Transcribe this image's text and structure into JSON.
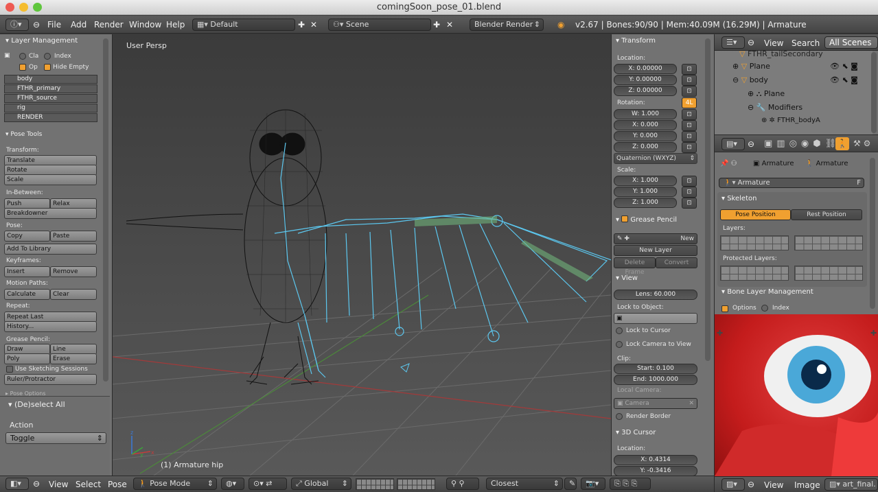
{
  "window": {
    "title": "comingSoon_pose_01.blend"
  },
  "topbar": {
    "menus": [
      "File",
      "Add",
      "Render",
      "Window",
      "Help"
    ],
    "screen_layout": "Default",
    "scene": "Scene",
    "render_engine": "Blender Render",
    "info": "v2.67 | Bones:90/90 | Mem:40.09M (16.29M) | Armature"
  },
  "left_panel": {
    "layer_management_title": "Layer Management",
    "cla": "Cla",
    "index": "Index",
    "op": "Op",
    "hide_empty": "Hide Empty",
    "layers": [
      "body",
      "FTHR_primary",
      "FTHR_source",
      "rig",
      "RENDER"
    ],
    "pose_tools_title": "Pose Tools",
    "transform_label": "Transform:",
    "translate": "Translate",
    "rotate": "Rotate",
    "scale": "Scale",
    "in_between_label": "In-Between:",
    "push": "Push",
    "relax": "Relax",
    "breakdowner": "Breakdowner",
    "pose_label": "Pose:",
    "copy": "Copy",
    "paste": "Paste",
    "add_to_library": "Add To Library",
    "keyframes_label": "Keyframes:",
    "insert": "Insert",
    "remove": "Remove",
    "motion_paths_label": "Motion Paths:",
    "calculate": "Calculate",
    "clear": "Clear",
    "repeat_label": "Repeat:",
    "repeat_last": "Repeat Last",
    "history": "History...",
    "grease_pencil_label": "Grease Pencil:",
    "draw": "Draw",
    "line": "Line",
    "poly": "Poly",
    "erase": "Erase",
    "use_sketching": "Use Sketching Sessions",
    "ruler": "Ruler/Protractor",
    "pose_options": "Pose Options",
    "deselect_all": "(De)select All",
    "action_label": "Action",
    "action_value": "Toggle"
  },
  "viewport": {
    "view_name": "User Persp",
    "selected": "(1) Armature hip"
  },
  "n_panel": {
    "transform_title": "Transform",
    "location_label": "Location:",
    "loc": [
      "X: 0.00000",
      "Y: 0.00000",
      "Z: 0.00000"
    ],
    "rotation_label": "Rotation:",
    "rot_badge": "4L",
    "rot": [
      "W: 1.000",
      "X: 0.000",
      "Y: 0.000",
      "Z: 0.000"
    ],
    "rotation_mode": "Quaternion (WXYZ)",
    "scale_label": "Scale:",
    "scale": [
      "X: 1.000",
      "Y: 1.000",
      "Z: 1.000"
    ],
    "grease_pencil_title": "Grease Pencil",
    "new": "New",
    "new_layer": "New Layer",
    "delete_frame": "Delete Frame",
    "convert": "Convert",
    "view_title": "View",
    "lens": "Lens: 60.000",
    "lock_to_object": "Lock to Object:",
    "lock_to_cursor": "Lock to Cursor",
    "lock_camera": "Lock Camera to View",
    "clip_label": "Clip:",
    "clip_start": "Start: 0.100",
    "clip_end": "End: 1000.000",
    "local_camera": "Local Camera:",
    "camera": "Camera",
    "render_border": "Render Border",
    "cursor_title": "3D Cursor",
    "cursor_location": "Location:",
    "cursor_x": "X: 0.4314",
    "cursor_y": "Y: -0.3416"
  },
  "outliner": {
    "view": "View",
    "search": "Search",
    "scope": "All Scenes",
    "items": [
      "FTHR_tailSecondary",
      "Plane",
      "body",
      "Plane",
      "Modifiers",
      "FTHR_bodyA"
    ]
  },
  "properties": {
    "breadcrumb1": "Armature",
    "breadcrumb2": "Armature",
    "datablock": "Armature",
    "fake_user": "F",
    "skeleton_title": "Skeleton",
    "pose_position": "Pose Position",
    "rest_position": "Rest Position",
    "layers_label": "Layers:",
    "protected_label": "Protected Layers:",
    "bone_layer_mgmt": "Bone Layer Management",
    "options": "Options",
    "index": "Index"
  },
  "image_editor": {
    "view": "View",
    "image": "Image",
    "image_name": "art_final."
  },
  "bottombar": {
    "menus": [
      "View",
      "Select",
      "Pose"
    ],
    "mode": "Pose Mode",
    "orientation": "Global",
    "snap": "Closest"
  },
  "colors": {
    "accent": "#f0a030",
    "bone": "#5cc8f0",
    "viewport_top": "#3b3b3b"
  }
}
